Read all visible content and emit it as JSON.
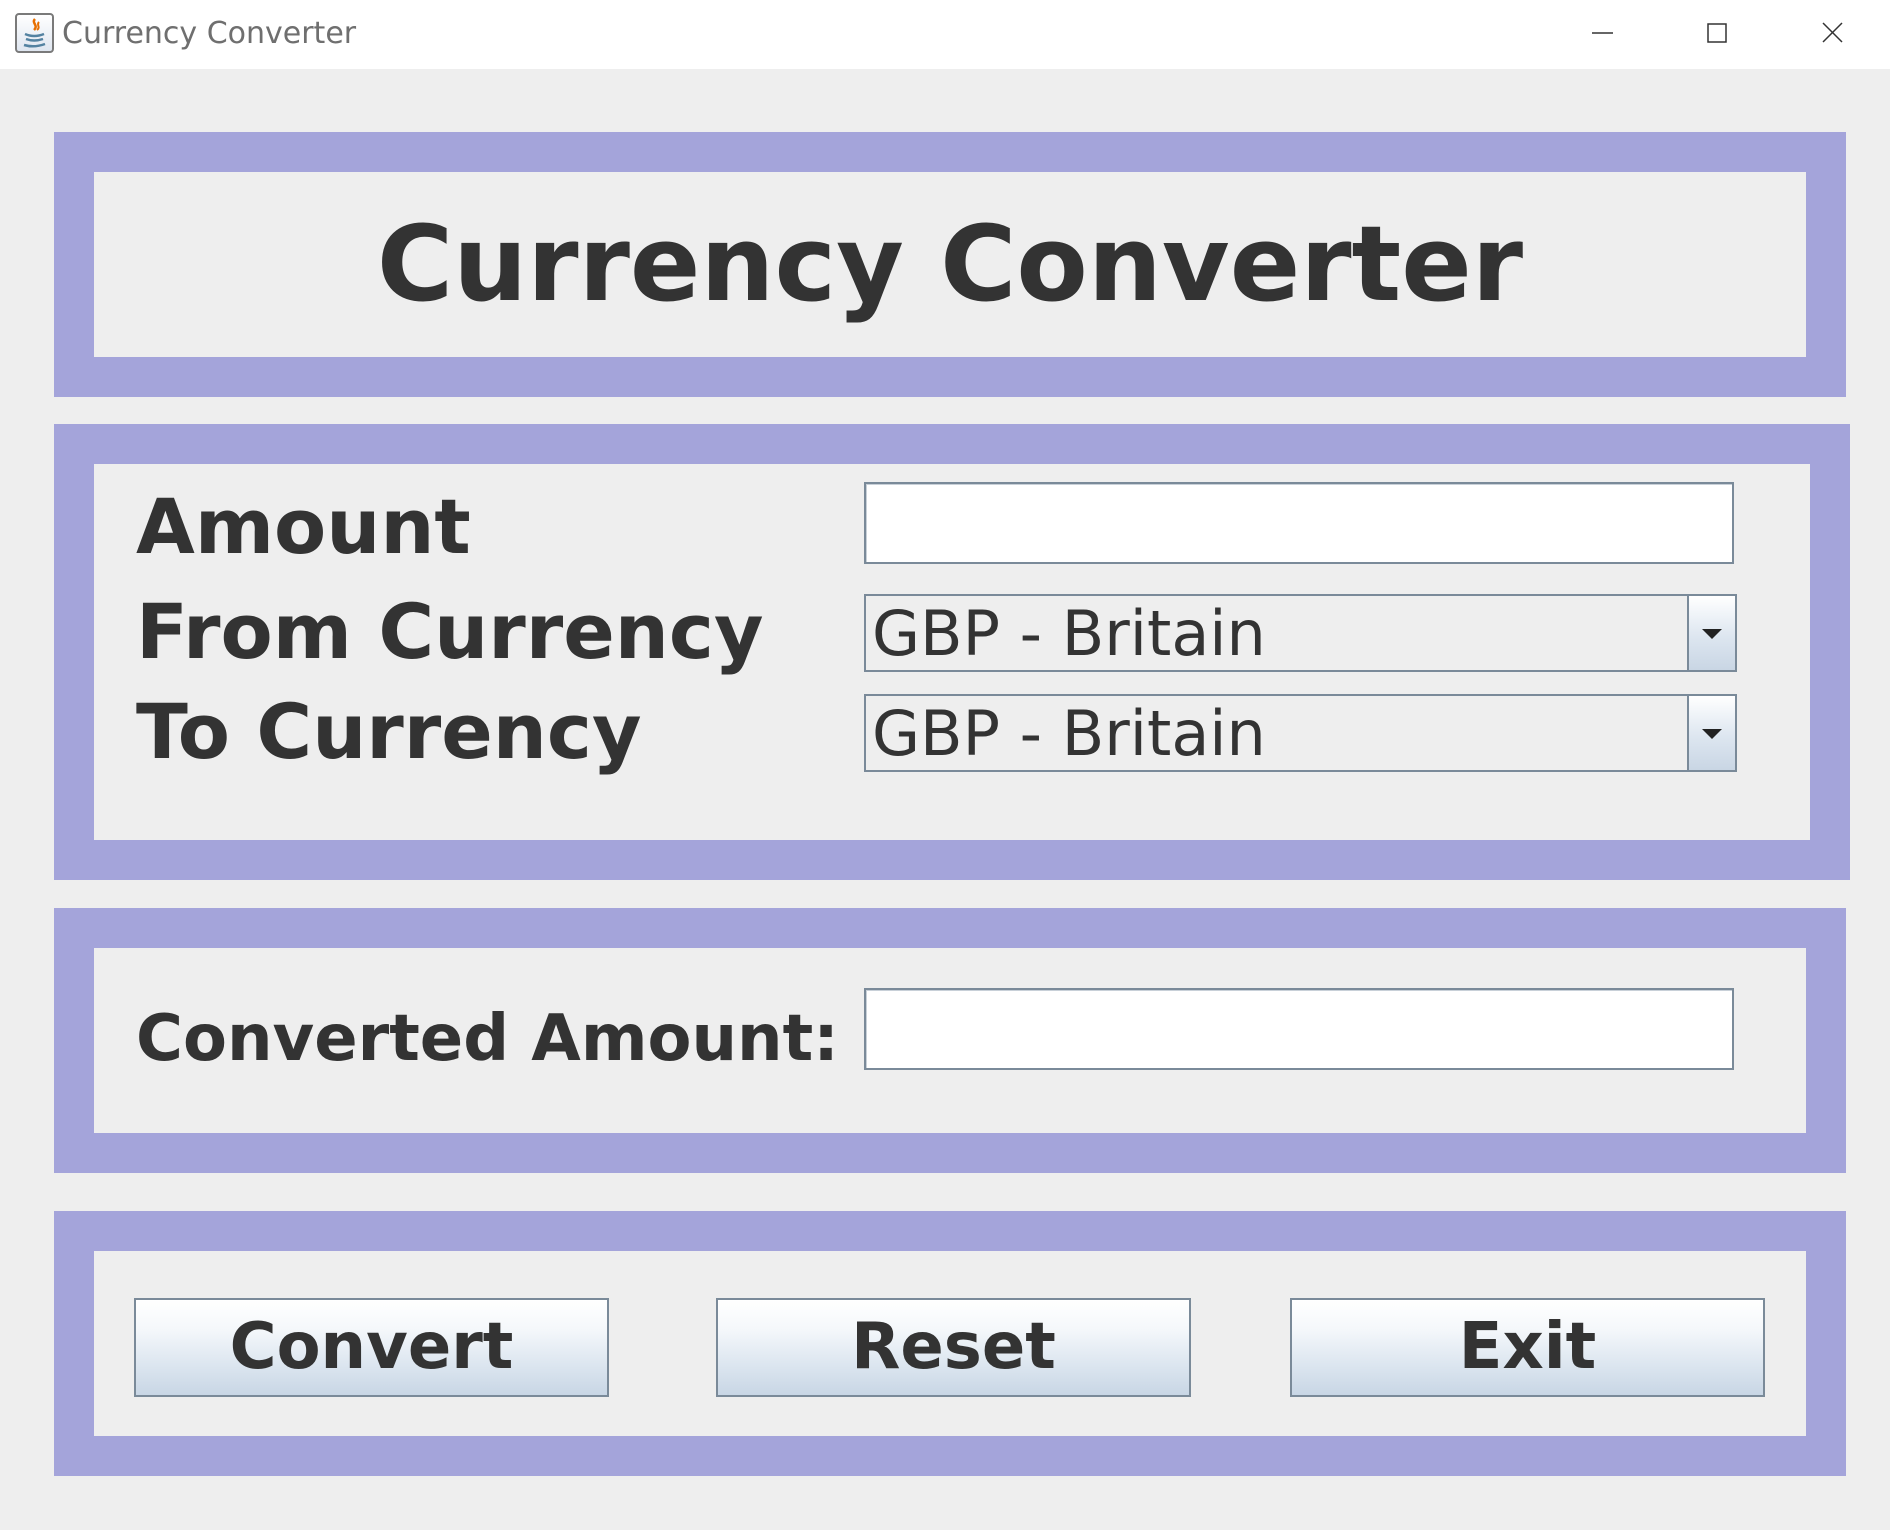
{
  "window": {
    "title": "Currency Converter",
    "icon": "java-app-icon",
    "controls": [
      "minimize-icon",
      "maximize-icon",
      "close-icon"
    ]
  },
  "header": {
    "title": "Currency Converter"
  },
  "form": {
    "amount_label": "Amount",
    "amount_value": "",
    "from_label": "From Currency",
    "from_value": "GBP - Britain",
    "to_label": "To Currency",
    "to_value": "GBP - Britain"
  },
  "result": {
    "label": "Converted Amount:",
    "value": ""
  },
  "actions": {
    "convert_label": "Convert",
    "reset_label": "Reset",
    "exit_label": "Exit"
  },
  "colors": {
    "panel_border": "#a4a4da",
    "background": "#eeeeee",
    "text": "#333333"
  }
}
